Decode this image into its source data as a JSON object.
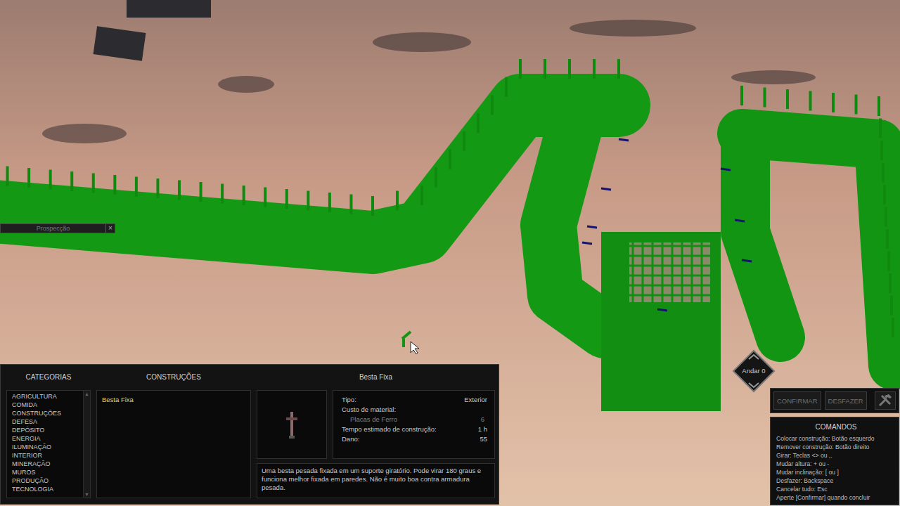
{
  "prospect_bar": {
    "label": "Prospecção",
    "close": "×"
  },
  "build_panel": {
    "categories_title": "CATEGORIAS",
    "categories": [
      "AGRICULTURA",
      "COMIDA",
      "CONSTRUÇÕES",
      "DEFESA",
      "DEPÓSITO",
      "ENERGIA",
      "ILUMINAÇÃO",
      "INTERIOR",
      "MINERAÇÃO",
      "MUROS",
      "PRODUÇÃO",
      "TECNOLOGIA"
    ],
    "scroll_up": "▲",
    "scroll_down": "▼",
    "constructions_title": "CONSTRUÇÕES",
    "constructions": [
      {
        "label": "Besta Fixa",
        "selected": true
      }
    ],
    "detail": {
      "title": "Besta Fixa",
      "fields": [
        {
          "label": "Tipo:",
          "value": "Exterior",
          "kind": "main"
        },
        {
          "label": "Custo de material:",
          "value": "",
          "kind": "main"
        },
        {
          "label": "Placas de Ferro",
          "value": "6",
          "kind": "sub"
        },
        {
          "label": "Tempo estimado de construção:",
          "value": "1 h",
          "kind": "main"
        },
        {
          "label": "Dano:",
          "value": "55",
          "kind": "main"
        }
      ],
      "description": "Uma besta pesada fixada em um suporte giratório. Pode virar 180 graus e funciona melhor fixada em paredes. Não é muito boa contra armadura pesada."
    }
  },
  "floor": {
    "label": "Andar 0"
  },
  "actions": [
    {
      "label": "CONFIRMAR",
      "disabled": true
    },
    {
      "label": "DESFAZER",
      "disabled": true
    }
  ],
  "commands": {
    "title": "COMANDOS",
    "lines": [
      "Colocar construção: Botão esquerdo",
      "Remover construção: Botão direito",
      "Girar: Teclas <> ou ,.",
      "Mudar altura: + ou -",
      "Mudar inclinação: [ ou ]",
      "Desfazer: Backspace",
      "Cancelar tudo: Esc",
      "Aperte [Confirmar] quando concluir"
    ]
  }
}
